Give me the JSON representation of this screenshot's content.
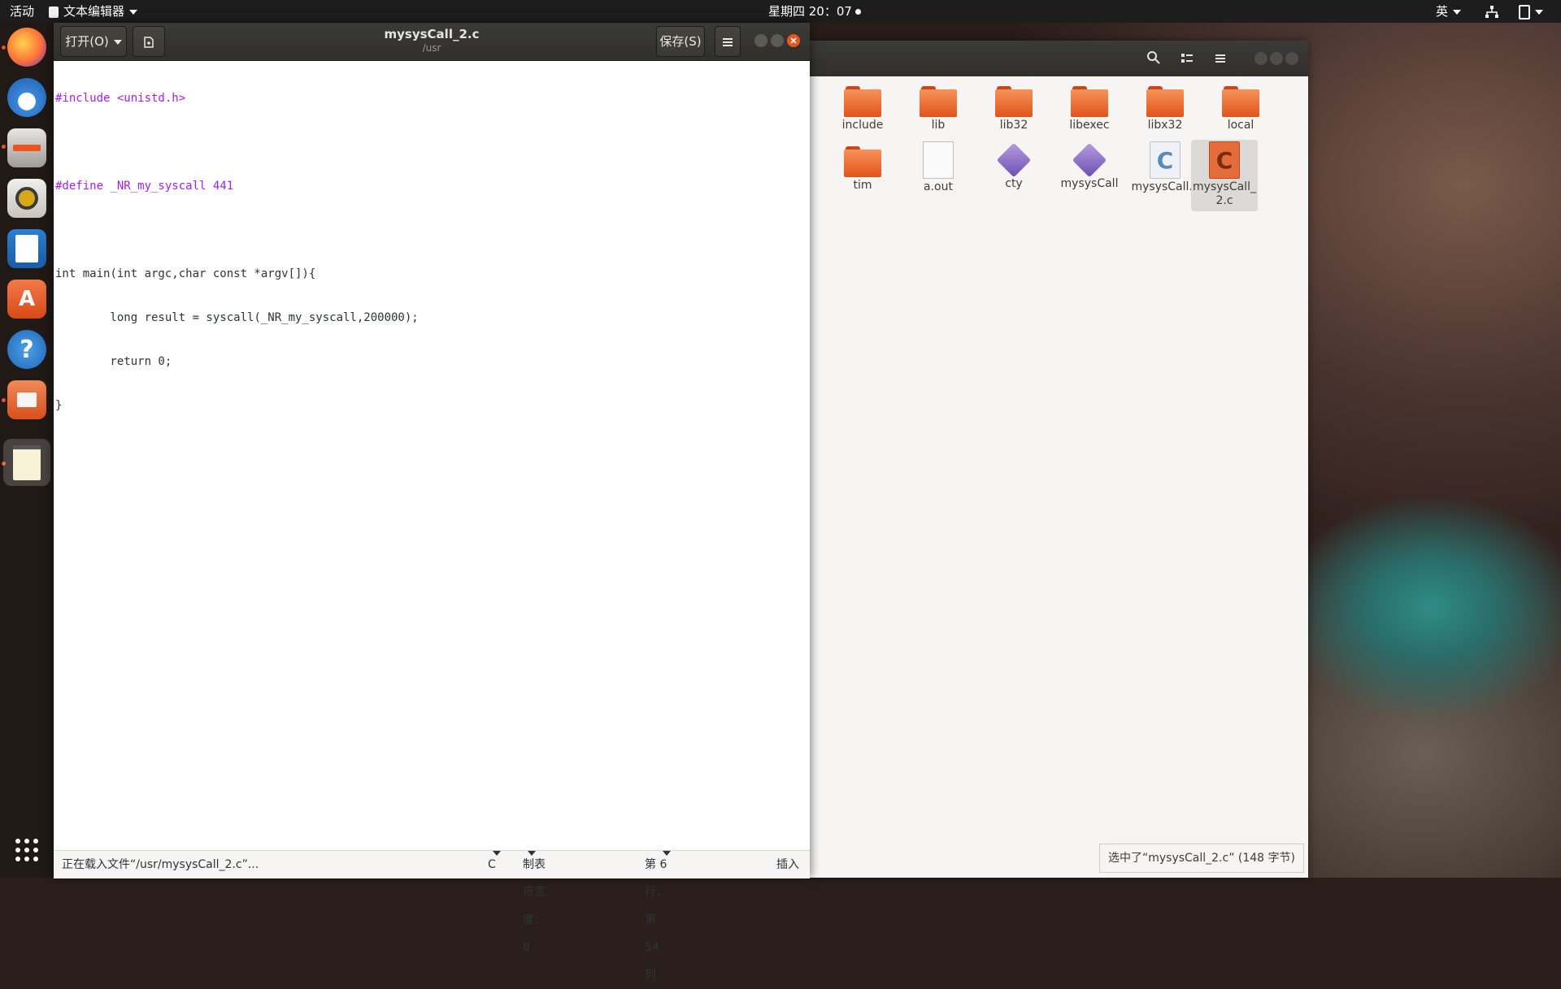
{
  "topbar": {
    "activities": "活动",
    "app_menu": "文本编辑器",
    "clock": "星期四 20：07",
    "input_method": "英"
  },
  "dock": {
    "items": [
      "firefox-icon",
      "thunderbird-icon",
      "files-icon",
      "rhythmbox-icon",
      "writer-icon",
      "software-icon",
      "help-icon",
      "archive-icon",
      "text-editor-icon"
    ]
  },
  "editor": {
    "open_label": "打开(O)",
    "save_label": "保存(S)",
    "title": "mysysCall_2.c",
    "subtitle": "/usr",
    "code": [
      "#include <unistd.h>",
      "",
      "#define _NR_my_syscall 441",
      "",
      "int main(int argc,char const *argv[]){",
      "        long result = syscall(_NR_my_syscall,200000);",
      "        return 0;",
      "}"
    ],
    "status": {
      "loading": "正在载入文件“/usr/mysysCall_2.c”...",
      "language": "C",
      "tab_width": "制表符宽度：8",
      "position": "第 6 行，第 54 列",
      "mode": "插入"
    }
  },
  "files": {
    "items": [
      {
        "name": "include",
        "kind": "folder"
      },
      {
        "name": "lib",
        "kind": "folder"
      },
      {
        "name": "lib32",
        "kind": "folder"
      },
      {
        "name": "libexec",
        "kind": "folder"
      },
      {
        "name": "libx32",
        "kind": "folder"
      },
      {
        "name": "local",
        "kind": "folder"
      },
      {
        "name": "tim",
        "kind": "folder"
      },
      {
        "name": "a.out",
        "kind": "doc"
      },
      {
        "name": "cty",
        "kind": "exec"
      },
      {
        "name": "mysysCall",
        "kind": "exec"
      },
      {
        "name": "mysysCall.c",
        "kind": "c"
      },
      {
        "name": "mysysCall_\n2.c",
        "kind": "c-selected"
      }
    ],
    "status": "选中了“mysysCall_2.c” (148 字节)"
  }
}
